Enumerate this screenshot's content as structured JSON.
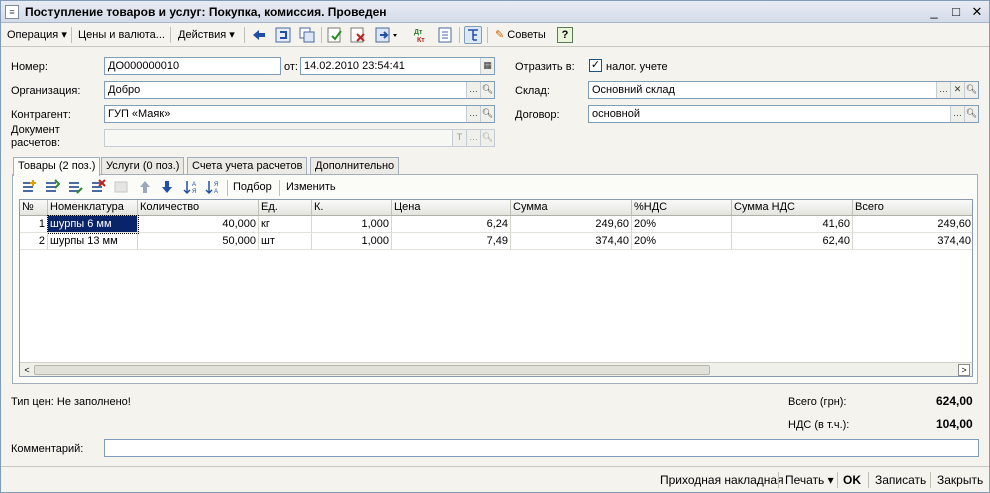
{
  "window": {
    "title": "Поступление товаров и услуг: Покупка, комиссия. Проведен",
    "minimize": "_",
    "maximize": "□",
    "close": "✕"
  },
  "toolbar": {
    "operation": "Операция",
    "prices": "Цены и валюта...",
    "actions": "Действия",
    "tips": "Советы",
    "help": "?"
  },
  "header": {
    "number_label": "Номер:",
    "number_value": "ДО000000010",
    "date_label": "от:",
    "date_value": "14.02.2010 23:54:41",
    "reflect_label": "Отразить в:",
    "tax_checkbox_label": "налог. учете",
    "tax_checked": true,
    "org_label": "Организация:",
    "org_value": "Добро",
    "warehouse_label": "Склад:",
    "warehouse_value": "Основний склад",
    "contractor_label": "Контрагент:",
    "contractor_value": "ГУП «Маяк»",
    "contract_label": "Договор:",
    "contract_value": "основной",
    "doc_label_1": "Документ",
    "doc_label_2": "расчетов:",
    "doc_value": ""
  },
  "tabs": [
    {
      "label": "Товары (2 поз.)"
    },
    {
      "label": "Услуги (0 поз.)"
    },
    {
      "label": "Счета учета расчетов"
    },
    {
      "label": "Дополнительно"
    }
  ],
  "grid_toolbar": {
    "selection": "Подбор",
    "change": "Изменить"
  },
  "grid": {
    "columns": [
      "№",
      "Номенклатура",
      "Количество",
      "Ед.",
      "К.",
      "Цена",
      "Сумма",
      "%НДС",
      "Сумма НДС",
      "Всего"
    ],
    "rows": [
      {
        "n": "1",
        "item": "шурпы 6 мм",
        "qty": "40,000",
        "unit": "кг",
        "k": "1,000",
        "price": "6,24",
        "sum": "249,60",
        "vat_rate": "20%",
        "vat_sum": "41,60",
        "total": "249,60"
      },
      {
        "n": "2",
        "item": "шурпы 13 мм",
        "qty": "50,000",
        "unit": "шт",
        "k": "1,000",
        "price": "7,49",
        "sum": "374,40",
        "vat_rate": "20%",
        "vat_sum": "62,40",
        "total": "374,40"
      }
    ]
  },
  "footer": {
    "price_type": "Тип цен: Не заполнено!",
    "total_label": "Всего (грн):",
    "total_value": "624,00",
    "vat_label": "НДС (в т.ч.):",
    "vat_value": "104,00",
    "comment_label": "Комментарий:",
    "comment_value": ""
  },
  "bottom": {
    "invoice": "Приходная накладная",
    "print": "Печать",
    "ok": "OK",
    "save": "Записать",
    "close": "Закрыть"
  },
  "colors": {
    "selection": "#0a246a",
    "window_bg": "#f4f3ee",
    "field_border": "#7f9db9"
  }
}
